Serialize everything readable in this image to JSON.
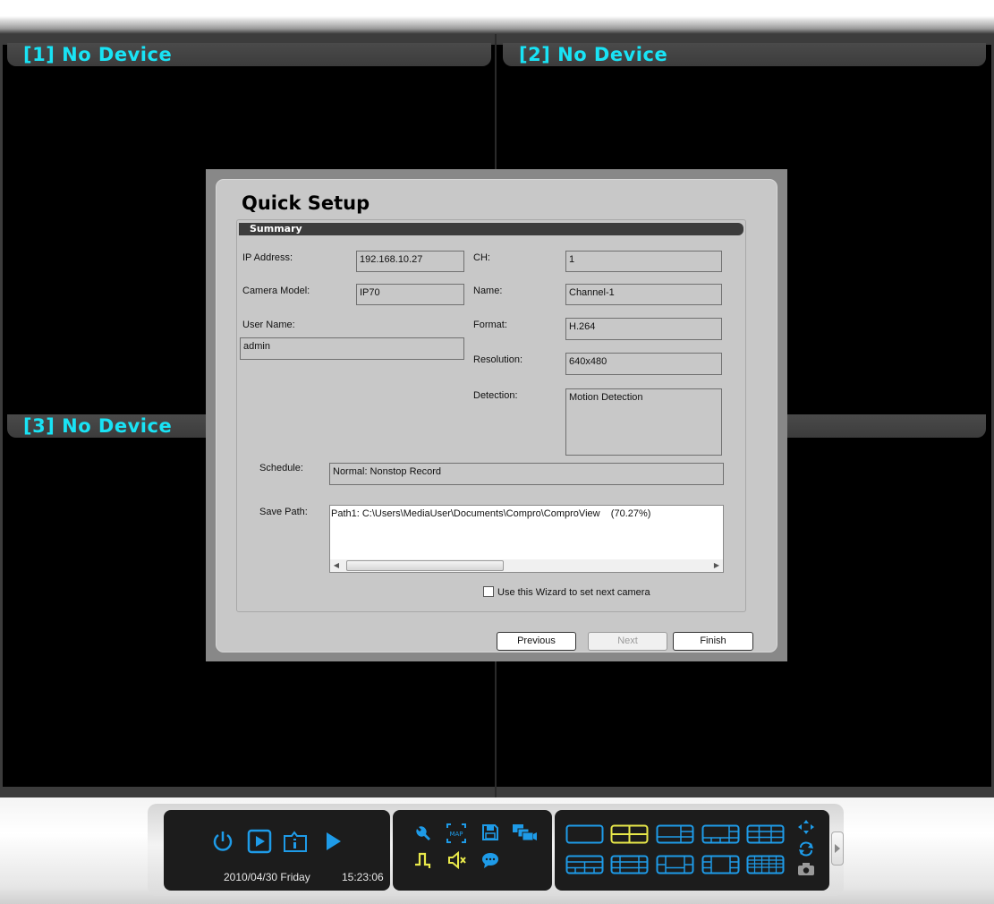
{
  "channels": [
    {
      "label": "[1] No Device"
    },
    {
      "label": "[2] No Device"
    },
    {
      "label": "[3] No Device"
    }
  ],
  "dialog": {
    "title": "Quick Setup",
    "section": "Summary",
    "fields": {
      "ip_label": "IP Address:",
      "ip_value": "192.168.10.27",
      "model_label": "Camera Model:",
      "model_value": "IP70",
      "user_label": "User Name:",
      "user_value": "admin",
      "ch_label": "CH:",
      "ch_value": "1",
      "name_label": "Name:",
      "name_value": "Channel-1",
      "format_label": "Format:",
      "format_value": "H.264",
      "resolution_label": "Resolution:",
      "resolution_value": "640x480",
      "detection_label": "Detection:",
      "detection_value": "Motion Detection",
      "schedule_label": "Schedule:",
      "schedule_value": "Normal: Nonstop Record",
      "savepath_label": "Save Path:",
      "savepath_value": "Path1: C:\\Users\\MediaUser\\Documents\\Compro\\ComproView    (70.27%)"
    },
    "scroll_thumb_grip": "III",
    "wizard_checkbox_label": "Use this Wizard to set next camera",
    "wizard_checkbox_checked": false,
    "buttons": {
      "previous": "Previous",
      "next": "Next",
      "finish": "Finish"
    }
  },
  "statusbar": {
    "date": "2010/04/30 Friday",
    "time": "15:23:06"
  },
  "colors": {
    "channel_label": "#19e3f5",
    "icon_blue": "#1e9be8",
    "icon_yellow": "#e8e84a"
  },
  "icons": {
    "left_group": [
      "power-icon",
      "playback-icon",
      "info-icon",
      "play-arrow-icon"
    ],
    "middle_group": [
      "wrench-icon",
      "map-icon",
      "save-icon",
      "camera-group-icon",
      "pulse-icon",
      "speaker-muted-icon",
      "chat-icon"
    ],
    "right_group": [
      "layout-1-icon",
      "layout-4-icon",
      "layout-6-icon",
      "layout-8-icon",
      "layout-9-icon",
      "layout-10-icon",
      "layout-13-icon",
      "layout-16a-icon",
      "layout-16b-icon",
      "layout-25-icon",
      "ptz-icon",
      "sequence-icon",
      "snapshot-icon"
    ]
  },
  "map_icon_text": "MAP"
}
